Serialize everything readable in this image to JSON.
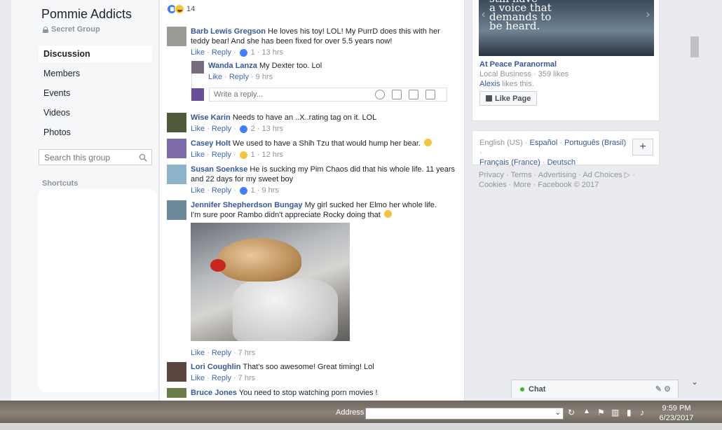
{
  "sidebar": {
    "group_name": "Pommie Addicts",
    "group_privacy": "Secret Group",
    "nav": [
      "Discussion",
      "Members",
      "Events",
      "Videos",
      "Photos"
    ],
    "search_placeholder": "Search this group",
    "shortcuts_label": "Shortcuts"
  },
  "feed": {
    "reaction_count": "14",
    "comments": [
      {
        "name": "Barb Lewis Gregson",
        "text": "He loves his toy! LOL! My PurrD does this with her teddy bear! And she has been fixed for over 5.5 years now!",
        "like": "Like",
        "reply": "Reply",
        "reacts": "1",
        "time": "13 hrs"
      },
      {
        "name": "Wanda Lanza",
        "text": "My Dexter too. Lol",
        "like": "Like",
        "reply": "Reply",
        "time": "9 hrs"
      },
      {
        "name": "Wise Karin",
        "text": "Needs to have an ..X..rating tag on it. LOL",
        "like": "Like",
        "reply": "Reply",
        "reacts": "2",
        "time": "13 hrs"
      },
      {
        "name": "Casey Holt",
        "text": "We used to have a Shih Tzu that would hump her bear.",
        "like": "Like",
        "reply": "Reply",
        "reacts": "1",
        "time": "12 hrs"
      },
      {
        "name": "Susan Soenkse",
        "text": "He is sucking my Pim Chaos did that his whole life. 11 years and 22 days for my sweet boy",
        "like": "Like",
        "reply": "Reply",
        "reacts": "1",
        "time": "9 hrs"
      },
      {
        "name": "Jennifer Shepherdson Bungay",
        "text": "My girl sucked her Elmo her whole life.",
        "text2": "I'm sure poor Rambo didn't appreciate Rocky doing that",
        "like": "Like",
        "reply": "Reply",
        "time": "7 hrs"
      },
      {
        "name": "Lori Coughlin",
        "text": "That's soo awesome! Great timing! Lol",
        "like": "Like",
        "reply": "Reply",
        "time": "7 hrs"
      },
      {
        "name": "Bruce Jones",
        "text": "You need to stop watching porn movies !"
      }
    ],
    "reply_placeholder": "Write a reply..."
  },
  "ad": {
    "quote": "still have\na voice that\ndemands to\nbe heard.",
    "page_name": "At Peace Paranormal",
    "category": "Local Business · 359 likes",
    "liker": "Alexis",
    "liker_suffix": " likes this.",
    "like_button": "Like Page"
  },
  "languages": {
    "current": "English (US) · ",
    "links": [
      "Español",
      "Português (Brasil)",
      "Français (France)",
      "Deutsch"
    ],
    "plus": "+"
  },
  "footer": "Privacy · Terms · Advertising · Ad Choices ▷ · Cookies · More · Facebook © 2017",
  "chat": {
    "label": "Chat"
  },
  "taskbar": {
    "address_label": "Address",
    "time": "9:59 PM",
    "date": "6/23/2017"
  },
  "colors": {
    "link": "#365899",
    "accent": "#4267b2",
    "bg": "#e9ebee"
  }
}
